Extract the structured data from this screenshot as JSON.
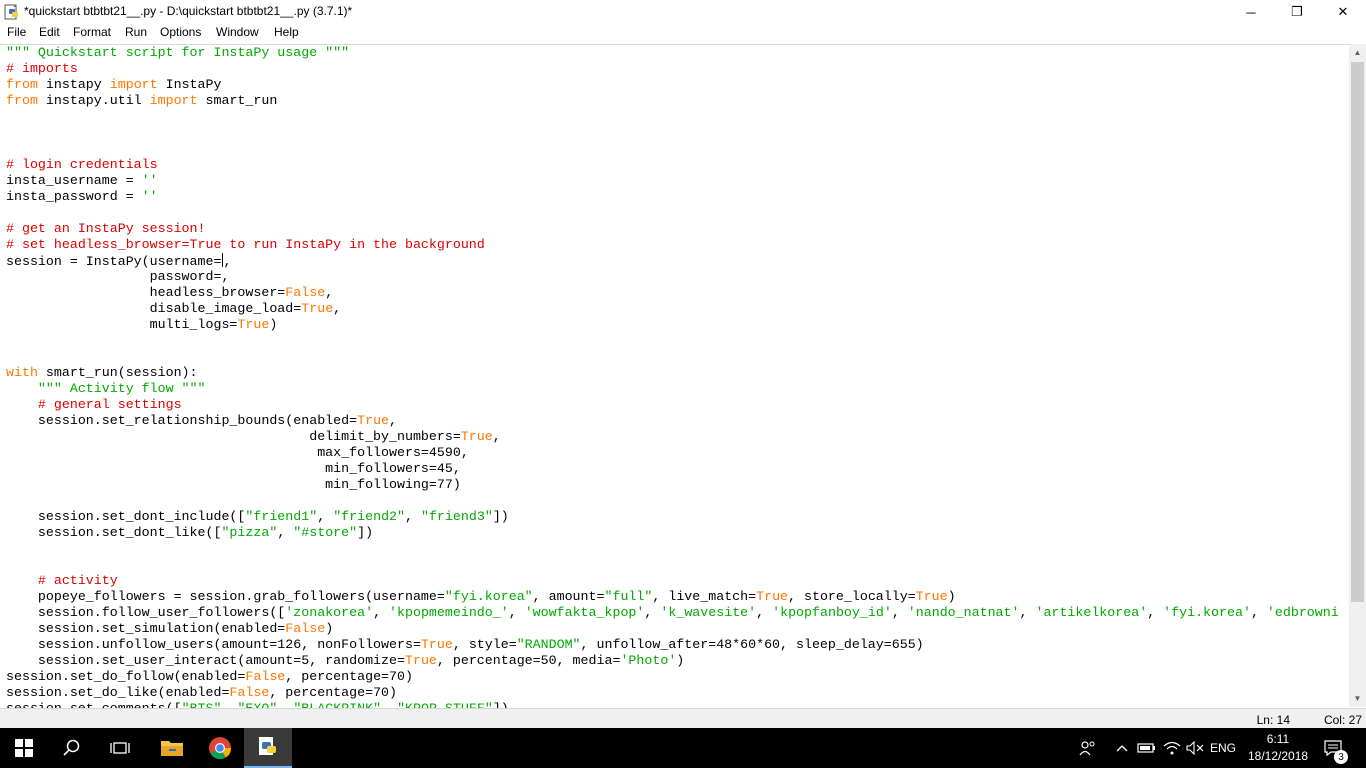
{
  "window": {
    "title": "*quickstart btbtbt21__.py - D:\\quickstart btbtbt21__.py (3.7.1)*",
    "minimize_glyph": "─",
    "maximize_glyph": "❐",
    "close_glyph": "✕"
  },
  "menu": [
    "File",
    "Edit",
    "Format",
    "Run",
    "Options",
    "Window",
    "Help"
  ],
  "status": {
    "line": "Ln: 14",
    "col": "Col: 27"
  },
  "taskbar": {
    "time": "6:11",
    "date": "18/12/2018",
    "language": "ENG",
    "notification_count": "3"
  },
  "colors": {
    "string": "#00aa00",
    "comment": "#dd0000",
    "keyword": "#ff7700",
    "text": "#000000"
  },
  "code_lines": [
    [
      [
        "str",
        "\"\"\" Quickstart script for InstaPy usage \"\"\""
      ]
    ],
    [
      [
        "cmt",
        "# imports"
      ]
    ],
    [
      [
        "kw",
        "from"
      ],
      [
        "",
        " instapy "
      ],
      [
        "kw",
        "import"
      ],
      [
        "",
        " InstaPy"
      ]
    ],
    [
      [
        "kw",
        "from"
      ],
      [
        "",
        " instapy.util "
      ],
      [
        "kw",
        "import"
      ],
      [
        "",
        " smart_run"
      ]
    ],
    [],
    [],
    [],
    [
      [
        "cmt",
        "# login credentials"
      ]
    ],
    [
      [
        "",
        "insta_username = "
      ],
      [
        "str",
        "''"
      ]
    ],
    [
      [
        "",
        "insta_password = "
      ],
      [
        "str",
        "''"
      ]
    ],
    [],
    [
      [
        "cmt",
        "# get an InstaPy session!"
      ]
    ],
    [
      [
        "cmt",
        "# set headless_browser=True to run InstaPy in the background"
      ]
    ],
    [
      [
        "",
        "session = InstaPy(username="
      ],
      [
        "caret",
        ""
      ],
      [
        "",
        ","
      ]
    ],
    [
      [
        "",
        "                  password=,"
      ]
    ],
    [
      [
        "",
        "                  headless_browser="
      ],
      [
        "kw",
        "False"
      ],
      [
        "",
        ","
      ]
    ],
    [
      [
        "",
        "                  disable_image_load="
      ],
      [
        "kw",
        "True"
      ],
      [
        "",
        ","
      ]
    ],
    [
      [
        "",
        "                  multi_logs="
      ],
      [
        "kw",
        "True"
      ],
      [
        "",
        ")"
      ]
    ],
    [],
    [],
    [
      [
        "kw",
        "with"
      ],
      [
        "",
        " smart_run(session):"
      ]
    ],
    [
      [
        "",
        "    "
      ],
      [
        "str",
        "\"\"\" Activity flow \"\"\""
      ]
    ],
    [
      [
        "",
        "    "
      ],
      [
        "cmt",
        "# general settings"
      ]
    ],
    [
      [
        "",
        "    session.set_relationship_bounds(enabled="
      ],
      [
        "kw",
        "True"
      ],
      [
        "",
        ","
      ]
    ],
    [
      [
        "",
        "                                      delimit_by_numbers="
      ],
      [
        "kw",
        "True"
      ],
      [
        "",
        ","
      ]
    ],
    [
      [
        "",
        "                                       max_followers=4590,"
      ]
    ],
    [
      [
        "",
        "                                        min_followers=45,"
      ]
    ],
    [
      [
        "",
        "                                        min_following=77)"
      ]
    ],
    [],
    [
      [
        "",
        "    session.set_dont_include(["
      ],
      [
        "str",
        "\"friend1\""
      ],
      [
        "",
        ", "
      ],
      [
        "str",
        "\"friend2\""
      ],
      [
        "",
        ", "
      ],
      [
        "str",
        "\"friend3\""
      ],
      [
        "",
        "])"
      ]
    ],
    [
      [
        "",
        "    session.set_dont_like(["
      ],
      [
        "str",
        "\"pizza\""
      ],
      [
        "",
        ", "
      ],
      [
        "str",
        "\"#store\""
      ],
      [
        "",
        "])"
      ]
    ],
    [],
    [],
    [
      [
        "",
        "    "
      ],
      [
        "cmt",
        "# activity"
      ]
    ],
    [
      [
        "",
        "    popeye_followers = session.grab_followers(username="
      ],
      [
        "str",
        "\"fyi.korea\""
      ],
      [
        "",
        ", amount="
      ],
      [
        "str",
        "\"full\""
      ],
      [
        "",
        ", live_match="
      ],
      [
        "kw",
        "True"
      ],
      [
        "",
        ", store_locally="
      ],
      [
        "kw",
        "True"
      ],
      [
        "",
        ")"
      ]
    ],
    [
      [
        "",
        "    session.follow_user_followers(["
      ],
      [
        "str",
        "'zonakorea'"
      ],
      [
        "",
        ", "
      ],
      [
        "str",
        "'kpopmemeindo_'"
      ],
      [
        "",
        ", "
      ],
      [
        "str",
        "'wowfakta_kpop'"
      ],
      [
        "",
        ", "
      ],
      [
        "str",
        "'k_wavesite'"
      ],
      [
        "",
        ", "
      ],
      [
        "str",
        "'kpopfanboy_id'"
      ],
      [
        "",
        ", "
      ],
      [
        "str",
        "'nando_natnat'"
      ],
      [
        "",
        ", "
      ],
      [
        "str",
        "'artikelkorea'"
      ],
      [
        "",
        ", "
      ],
      [
        "str",
        "'fyi.korea'"
      ],
      [
        "",
        ", "
      ],
      [
        "str",
        "'edbrowni"
      ]
    ],
    [
      [
        "",
        "    session.set_simulation(enabled="
      ],
      [
        "kw",
        "False"
      ],
      [
        "",
        ")"
      ]
    ],
    [
      [
        "",
        "    session.unfollow_users(amount=126, nonFollowers="
      ],
      [
        "kw",
        "True"
      ],
      [
        "",
        ", style="
      ],
      [
        "str",
        "\"RANDOM\""
      ],
      [
        "",
        ", unfollow_after=48*60*60, sleep_delay=655)"
      ]
    ],
    [
      [
        "",
        "    session.set_user_interact(amount=5, randomize="
      ],
      [
        "kw",
        "True"
      ],
      [
        "",
        ", percentage=50, media="
      ],
      [
        "str",
        "'Photo'"
      ],
      [
        "",
        ")"
      ]
    ],
    [
      [
        "",
        "session.set_do_follow(enabled="
      ],
      [
        "kw",
        "False"
      ],
      [
        "",
        ", percentage=70)"
      ]
    ],
    [
      [
        "",
        "session.set_do_like(enabled="
      ],
      [
        "kw",
        "False"
      ],
      [
        "",
        ", percentage=70)"
      ]
    ],
    [
      [
        "",
        "session.set_comments(["
      ],
      [
        "str",
        "\"BTS\""
      ],
      [
        "",
        ", "
      ],
      [
        "str",
        "\"EXO\""
      ],
      [
        "",
        ", "
      ],
      [
        "str",
        "\"BLACKPINK\""
      ],
      [
        "",
        ", "
      ],
      [
        "str",
        "\"KPOP STUFF\""
      ],
      [
        "",
        "])"
      ]
    ]
  ]
}
